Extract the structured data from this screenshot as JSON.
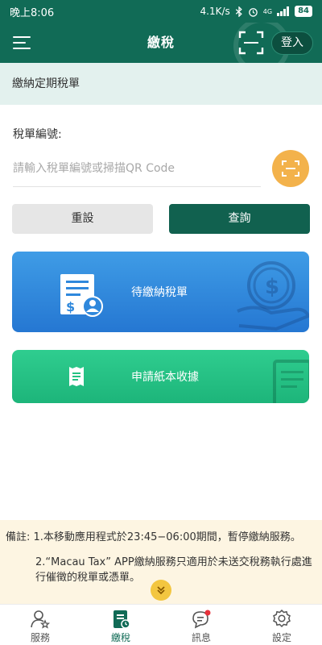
{
  "status_bar": {
    "time": "晚上8:06",
    "speed": "4.1K/s",
    "signal": "4G",
    "battery": "84"
  },
  "app_bar": {
    "title": "繳稅",
    "login_label": "登入",
    "menu_icon": "menu-icon",
    "scan_icon": "qr-scan-icon"
  },
  "section": {
    "title": "繳納定期稅單"
  },
  "form": {
    "label": "稅單編號:",
    "placeholder": "請輸入稅單編號或掃描QR Code",
    "value": "",
    "reset_label": "重設",
    "query_label": "查詢"
  },
  "cards": {
    "pending": "待繳納稅單",
    "receipt": "申請紙本收據"
  },
  "notice": {
    "line1": "備註: 1.本移動應用程式於23:45−06:00期間，暫停繳納服務。",
    "line2": "2.“Macau Tax” APP繳納服務只適用於未送交稅務執行處進行催徵的稅單或憑單。"
  },
  "tabs": [
    {
      "label": "服務",
      "icon": "service-user-icon"
    },
    {
      "label": "繳稅",
      "icon": "tax-document-icon",
      "active": true
    },
    {
      "label": "訊息",
      "icon": "message-bubble-icon",
      "badge": true
    },
    {
      "label": "設定",
      "icon": "settings-gear-icon"
    }
  ],
  "colors": {
    "primary": "#116b56",
    "section_bg": "#e3f1ee",
    "scan_button": "#f3b24b",
    "card_blue": "#2f88dc",
    "card_green": "#24c283",
    "notice_bg": "#fdf5e2",
    "badge": "#e8323c"
  }
}
